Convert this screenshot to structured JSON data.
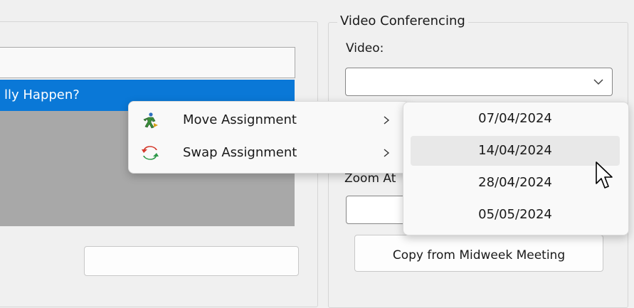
{
  "left_panel": {
    "selected_item_text": "lly Happen?",
    "bottom_button_label": ""
  },
  "right_panel": {
    "group_title": "Video Conferencing",
    "video_label": "Video:",
    "video_value": "",
    "zoom_label": "Zoom At",
    "zoom_value": "",
    "copy_button_label": "Copy from Midweek Meeting"
  },
  "context_menu": {
    "items": [
      {
        "label": "Move Assignment",
        "icon": "move-assignment-icon",
        "has_submenu": true
      },
      {
        "label": "Swap Assignment",
        "icon": "swap-assignment-icon",
        "has_submenu": true
      }
    ]
  },
  "submenu": {
    "items": [
      {
        "label": "07/04/2024"
      },
      {
        "label": "14/04/2024"
      },
      {
        "label": "28/04/2024"
      },
      {
        "label": "05/05/2024"
      }
    ],
    "hovered_index": 1
  },
  "colors": {
    "selection_blue": "#0a78d7",
    "window_bg": "#f0f0f0",
    "menu_bg": "#f9f9f9",
    "list_empty_gray": "#a8a8a8"
  }
}
